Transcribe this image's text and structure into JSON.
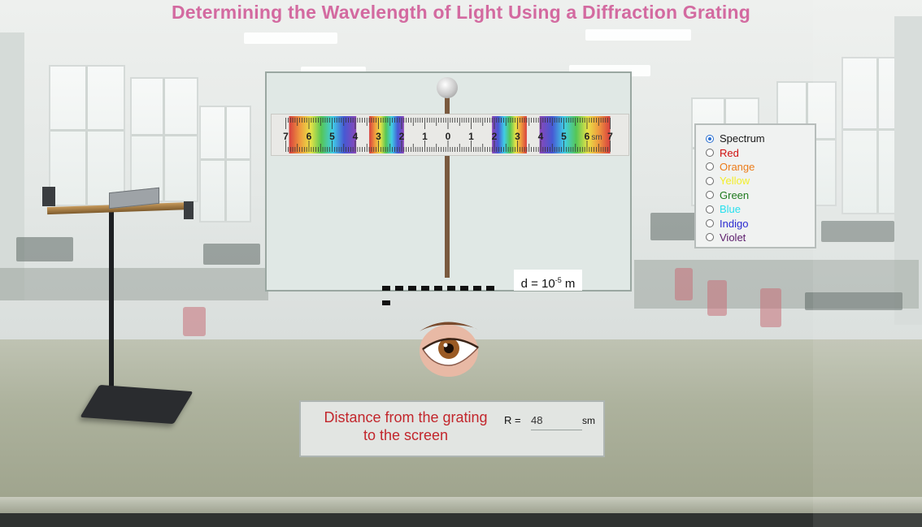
{
  "title": "Determining the Wavelength of Light Using a Diffraction Grating",
  "ruler": {
    "unit": "sm",
    "left_ticks": [
      "7",
      "6",
      "5",
      "4",
      "3",
      "2",
      "1",
      "0"
    ],
    "right_ticks": [
      "1",
      "2",
      "3",
      "4",
      "5",
      "6",
      "7"
    ]
  },
  "grating_label": {
    "prefix": "d = 10",
    "exponent": "-5",
    "unit": "m"
  },
  "radio_options": [
    {
      "label": "Spectrum",
      "color": "#1a1a1a",
      "checked": true
    },
    {
      "label": "Red",
      "color": "#d01010",
      "checked": false
    },
    {
      "label": "Orange",
      "color": "#ec7c1a",
      "checked": false
    },
    {
      "label": "Yellow",
      "color": "#f2ee2a",
      "checked": false
    },
    {
      "label": "Green",
      "color": "#1f7a1f",
      "checked": false
    },
    {
      "label": "Blue",
      "color": "#27e0ee",
      "checked": false
    },
    {
      "label": "Indigo",
      "color": "#2a2ad0",
      "checked": false
    },
    {
      "label": "Violet",
      "color": "#5a1a6a",
      "checked": false
    }
  ],
  "distance": {
    "caption_line1": "Distance from the grating",
    "caption_line2": "to the screen",
    "r_label": "R =",
    "r_value": "48",
    "r_unit": "sm"
  }
}
